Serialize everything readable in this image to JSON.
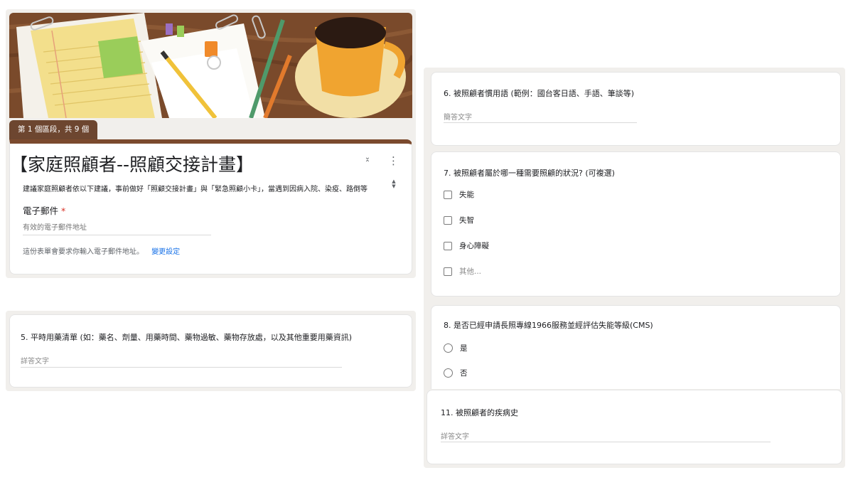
{
  "header_section": {
    "section_badge": "第 1 個區段，共 9 個",
    "form_title": "【家庭照顧者--照顧交接計畫】",
    "description": "建議家庭照顧者依以下建議，事前做好「照顧交接計畫」與「緊急照顧小卡」，當遇到因病入院、染疫、路倒等",
    "email_label": "電子郵件",
    "required_mark": "*",
    "email_placeholder": "有效的電子郵件地址",
    "note": "這份表單會要求你輸入電子郵件地址。",
    "change_settings": "變更設定"
  },
  "questions": {
    "q5": {
      "title": "5. 平時用藥清單 (如：藥名、劑量、用藥時間、藥物過敏、藥物存放處，以及其他重要用藥資訊)",
      "placeholder": "詳答文字"
    },
    "q6": {
      "title": "6. 被照顧者慣用語 (範例：國台客日語、手語、筆談等)",
      "placeholder": "簡答文字"
    },
    "q7": {
      "title": "7. 被照顧者屬於哪一種需要照顧的狀況? (可複選)",
      "options": [
        "失能",
        "失智",
        "身心障礙",
        "其他..."
      ]
    },
    "q8": {
      "title": "8. 是否已經申請長照專線1966服務並經評估失能等級(CMS)",
      "options": [
        "是",
        "否"
      ]
    },
    "q11": {
      "title": "11. 被照顧者的疾病史",
      "placeholder": "詳答文字"
    }
  },
  "colors": {
    "accent": "#7b4a2e",
    "link": "#1a73e8",
    "required": "#d93025"
  }
}
